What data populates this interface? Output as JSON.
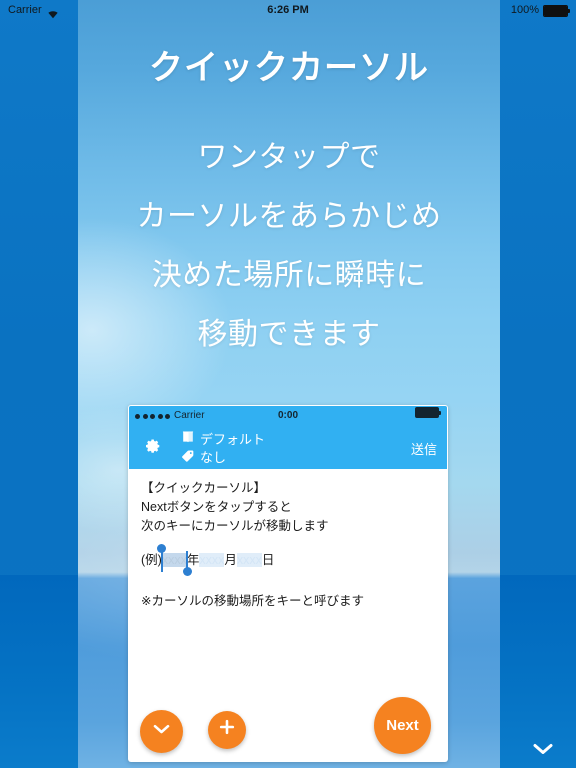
{
  "device_status_bar": {
    "carrier": "Carrier",
    "wifi_icon": "wifi-icon",
    "time": "6:26 PM",
    "battery_percent": "100%",
    "battery_icon": "battery-full-icon"
  },
  "page": {
    "headline": "クイックカーソル",
    "tagline_lines": [
      "ワンタップで",
      "カーソルをあらかじめ",
      "決めた場所に瞬時に",
      "移動できます"
    ],
    "scroll_hint_icon": "chevron-down-icon"
  },
  "phone": {
    "status_bar": {
      "signal_icon": "signal-dots-icon",
      "carrier": "Carrier",
      "time": "0:00",
      "battery_icon": "battery-full-icon"
    },
    "nav_bar": {
      "settings_icon": "gear-icon",
      "template_icon": "book-icon",
      "template_label": "デフォルト",
      "tag_icon": "tag-icon",
      "tag_label": "なし",
      "send_label": "送信"
    },
    "body": {
      "lines": [
        "【クイックカーソル】",
        "Nextボタンをタップすると",
        "次のキーにカーソルが移動します"
      ],
      "key_line": {
        "prefix": "(例)",
        "selected_key": "xxxx",
        "sep1": "年",
        "key2": "xxxx",
        "sep2": "月",
        "key3": "xxxx",
        "sep3": "日"
      },
      "note": "※カーソルの移動場所をキーと呼びます"
    },
    "actions": {
      "down_icon": "chevron-down-icon",
      "add_icon": "plus-icon",
      "next_label": "Next"
    }
  },
  "colors": {
    "accent_orange": "#f58220",
    "nav_blue": "#31b0f2",
    "band_blue": "#0a72c1",
    "selection_blue": "#2d7fd1",
    "key_highlight": "#c4d8ec",
    "key_plain": "#e0edf9"
  }
}
